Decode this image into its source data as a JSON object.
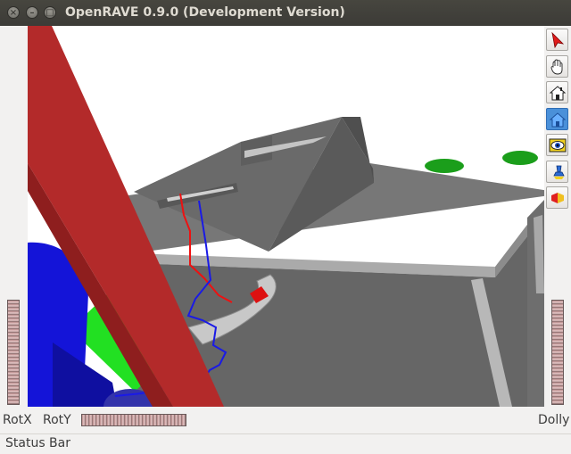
{
  "window": {
    "title": "OpenRAVE 0.9.0 (Development Version)",
    "buttons": [
      {
        "name": "close",
        "glyph": "×"
      },
      {
        "name": "minimize",
        "glyph": "–"
      },
      {
        "name": "maximize",
        "glyph": "□"
      }
    ]
  },
  "toolbar": {
    "tools": [
      {
        "name": "select-arrow-icon",
        "active": false
      },
      {
        "name": "pan-hand-icon",
        "active": false
      },
      {
        "name": "home-icon",
        "active": false
      },
      {
        "name": "set-home-icon",
        "active": true
      },
      {
        "name": "view-all-icon",
        "active": false
      },
      {
        "name": "seek-flashlight-icon",
        "active": false
      },
      {
        "name": "perspective-toggle-icon",
        "active": false
      }
    ]
  },
  "wheels": {
    "rotx_label": "RotX",
    "roty_label": "RotY",
    "dolly_label": "Dolly"
  },
  "status": {
    "text": "Status Bar"
  },
  "colors": {
    "titlebar": "#3c3b37",
    "background": "#f2f1f0",
    "viewport": "#ffffff",
    "wheel": "#b58787"
  }
}
